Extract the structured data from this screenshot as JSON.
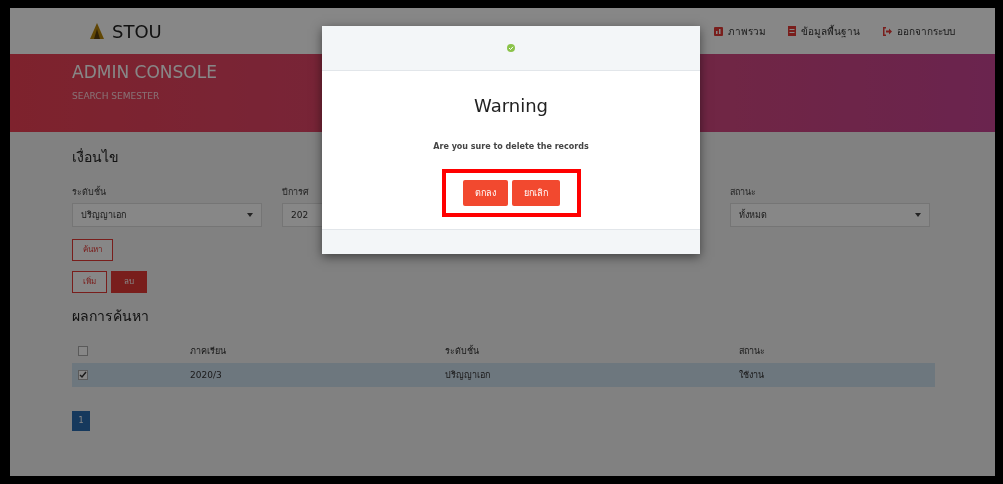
{
  "header": {
    "brand": "STOU",
    "nav": [
      {
        "label": "ภาพรวม",
        "kind": "overview"
      },
      {
        "label": "ข้อมูลพื้นฐาน",
        "kind": "data"
      },
      {
        "label": "ออกจากระบบ",
        "kind": "logout"
      }
    ]
  },
  "banner": {
    "title": "ADMIN CONSOLE",
    "subtitle": "SEARCH SEMESTER"
  },
  "filters": {
    "heading": "เงื่อนไข",
    "fields": [
      {
        "label": "ระดับชั้น",
        "value": "ปริญญาเอก",
        "kind": "select"
      },
      {
        "label": "ปีการศ",
        "value": "202",
        "kind": "field"
      },
      {
        "label": "สถานะ",
        "value": "ทั้งหมด",
        "kind": "select"
      }
    ],
    "search_button": "ค้นหา",
    "add_button": "เพิ่ม",
    "delete_button": "ลบ"
  },
  "results": {
    "heading": "ผลการค้นหา",
    "all_checked": false,
    "columns": [
      "ภาคเรียน",
      "ระดับชั้น",
      "สถานะ"
    ],
    "rows": [
      {
        "cells": [
          "2020/3",
          "ปริญญาเอก",
          "ใช้งาน"
        ],
        "checked": true,
        "selected": true
      }
    ],
    "pages": [
      {
        "label": "1",
        "selected": true
      }
    ]
  },
  "dialog": {
    "title": "Warning",
    "message": "Are you sure to delete the records",
    "buttons": [
      "ตกลง",
      "ยกเลิก"
    ],
    "highlighted": true
  }
}
